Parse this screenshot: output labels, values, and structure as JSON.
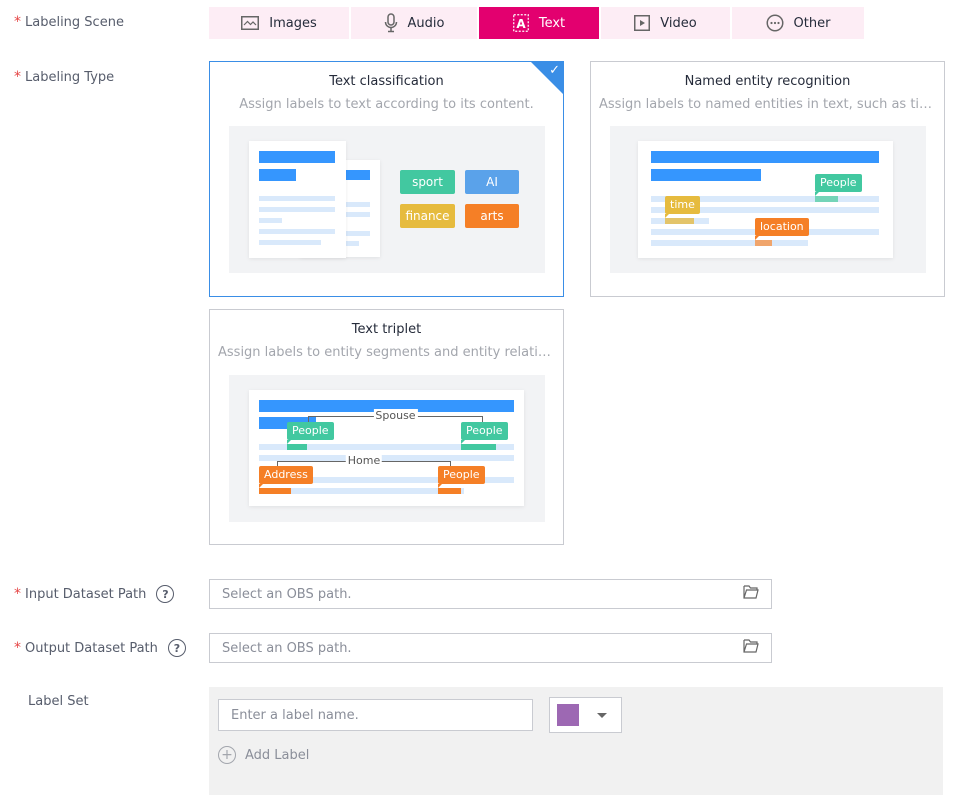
{
  "form": {
    "scene_label": "Labeling Scene",
    "type_label": "Labeling Type",
    "input_label": "Input Dataset Path",
    "output_label": "Output Dataset Path",
    "labelset_label": "Label Set",
    "required_mark": "*",
    "help_glyph": "?"
  },
  "scene_tabs": [
    {
      "label": "Images",
      "icon": "image-icon",
      "active": false
    },
    {
      "label": "Audio",
      "icon": "microphone-icon",
      "active": false
    },
    {
      "label": "Text",
      "icon": "text-icon",
      "active": true
    },
    {
      "label": "Video",
      "icon": "video-play-icon",
      "active": false
    },
    {
      "label": "Other",
      "icon": "more-circle-icon",
      "active": false
    }
  ],
  "type_cards": [
    {
      "title": "Text classification",
      "desc": "Assign labels to text according to its content.",
      "selected": true,
      "tags": [
        "sport",
        "AI",
        "finance",
        "arts"
      ]
    },
    {
      "title": "Named entity recognition",
      "desc": "Assign labels to named entities in text, such as time, location, and people.",
      "selected": false,
      "tags": [
        "People",
        "time",
        "location"
      ]
    },
    {
      "title": "Text triplet",
      "desc": "Assign labels to entity segments and entity relationships in text.",
      "selected": false,
      "tags": [
        "People",
        "People",
        "Address",
        "People"
      ],
      "relations": [
        "Spouse",
        "Home"
      ]
    }
  ],
  "check_glyph": "✓",
  "input_path": {
    "value": "",
    "placeholder": "Select an OBS path."
  },
  "output_path": {
    "value": "",
    "placeholder": "Select an OBS path."
  },
  "label_set": {
    "name_value": "",
    "name_placeholder": "Enter a label name.",
    "color": "#9d68b3",
    "add_label": "Add Label",
    "add_glyph": "+"
  },
  "colors": {
    "accent": "#e3006f",
    "selected_border": "#3a8ee6",
    "tag_green": "#42c8a0",
    "tag_blue": "#5aa2ea",
    "tag_yellow": "#e6bb3e",
    "tag_orange": "#f57f26"
  }
}
